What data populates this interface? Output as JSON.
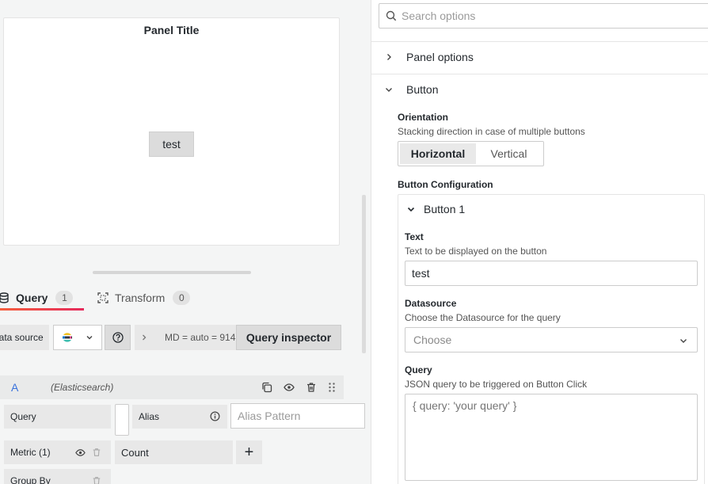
{
  "panel": {
    "title": "Panel Title",
    "button_label": "test"
  },
  "query_tabs": [
    {
      "label": "Query",
      "count": "1",
      "icon": "database-icon",
      "active": true
    },
    {
      "label": "Transform",
      "count": "0",
      "icon": "transform-icon",
      "active": false
    }
  ],
  "query_toolbar": {
    "datasource_label": "Data source",
    "datasource_icon": "elasticsearch-logo",
    "options_summary": "MD = auto = 914",
    "query_inspector_label": "Query inspector"
  },
  "query_row": {
    "ref_id": "A",
    "datasource_name": "(Elasticsearch)",
    "query_label": "Query",
    "alias_label": "Alias",
    "alias_placeholder": "Alias Pattern",
    "metric_label": "Metric (1)",
    "metric_value": "Count",
    "group_by_label": "Group By",
    "add_symbol": "+"
  },
  "options": {
    "search_placeholder": "Search options",
    "sections": [
      {
        "label": "Panel options",
        "expanded": false
      },
      {
        "label": "Button",
        "expanded": true
      }
    ],
    "orientation": {
      "label": "Orientation",
      "description": "Stacking direction in case of multiple buttons",
      "options": [
        "Horizontal",
        "Vertical"
      ],
      "selected": "Horizontal"
    },
    "button_configuration": {
      "label": "Button Configuration",
      "item_title": "Button 1",
      "text": {
        "label": "Text",
        "description": "Text to be displayed on the button",
        "value": "test"
      },
      "datasource": {
        "label": "Datasource",
        "description": "Choose the Datasource for the query",
        "placeholder": "Choose"
      },
      "query": {
        "label": "Query",
        "description": "JSON query to be triggered on Button Click",
        "placeholder": "{ query: 'your query' }"
      }
    }
  },
  "colors": {
    "accent_gradient_start": "#f55f3e",
    "accent_gradient_end": "#e52a5b",
    "ref_id": "#3871dc"
  }
}
